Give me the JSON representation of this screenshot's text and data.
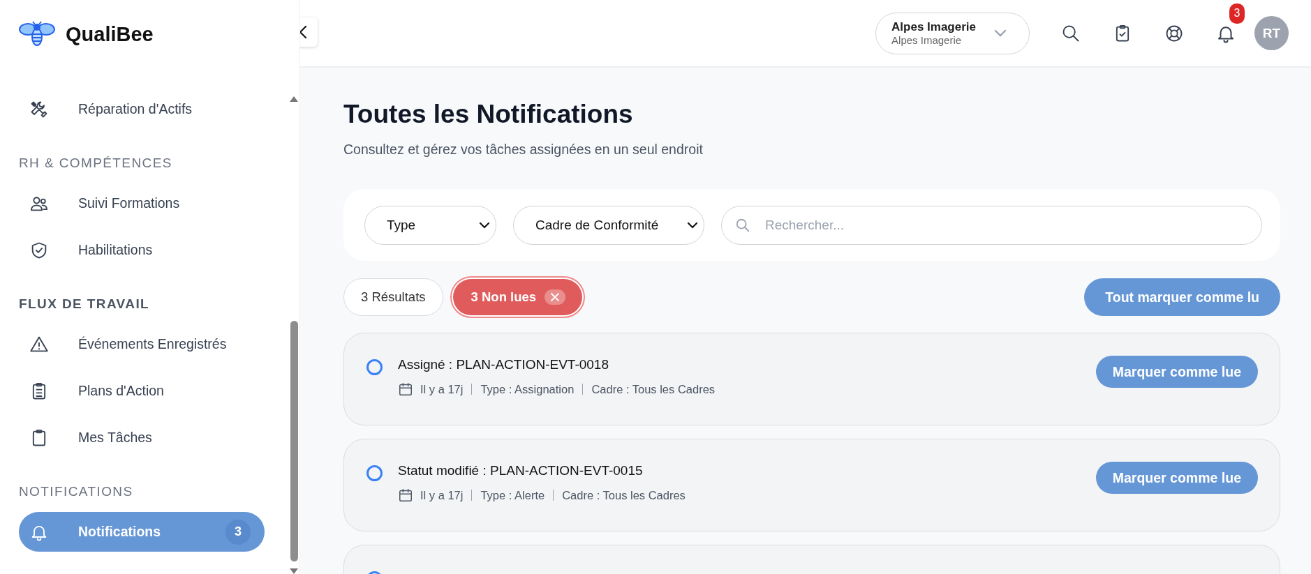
{
  "brand": {
    "name": "QualiBee"
  },
  "sidebar": {
    "sections": [
      {
        "items": [
          {
            "label": "Réparation d'Actifs",
            "selected": false
          }
        ]
      },
      {
        "title": "RH & COMPÉTENCES",
        "bold": false,
        "items": [
          {
            "label": "Suivi Formations",
            "selected": false
          },
          {
            "label": "Habilitations",
            "selected": false
          }
        ]
      },
      {
        "title": "FLUX DE TRAVAIL",
        "bold": true,
        "items": [
          {
            "label": "Événements Enregistrés",
            "selected": false
          },
          {
            "label": "Plans d'Action",
            "selected": false
          },
          {
            "label": "Mes Tâches",
            "selected": false
          }
        ]
      },
      {
        "title": "NOTIFICATIONS",
        "bold": false,
        "items": [
          {
            "label": "Notifications",
            "selected": true,
            "badge": "3"
          }
        ]
      }
    ]
  },
  "header": {
    "company": {
      "name": "Alpes Imagerie",
      "subtitle": "Alpes Imagerie"
    },
    "notification_count": "3",
    "avatar": "RT"
  },
  "page": {
    "title": "Toutes les Notifications",
    "subtitle": "Consultez et gérez vos tâches assignées en un seul endroit",
    "filters": [
      {
        "kind": "select",
        "label": "Type"
      },
      {
        "kind": "select",
        "label": "Cadre de Conformité"
      },
      {
        "kind": "search",
        "placeholder": "Rechercher..."
      }
    ],
    "results": "3 Résultats",
    "unread_filter": {
      "label": "3 Non lues",
      "active": true
    },
    "mark_all": "Tout marquer comme lu",
    "notifications": [
      {
        "title": "Assigné : PLAN-ACTION-EVT-0018",
        "time": "Il y a 17j",
        "type": "Type : Assignation",
        "frame": "Cadre : Tous les Cadres",
        "read": false,
        "action": "Marquer comme lue"
      },
      {
        "title": "Statut modifié : PLAN-ACTION-EVT-0015",
        "time": "Il y a 17j",
        "type": "Type : Alerte",
        "frame": "Cadre : Tous les Cadres",
        "read": false,
        "action": "Marquer comme lue"
      },
      {
        "read": false
      }
    ]
  }
}
